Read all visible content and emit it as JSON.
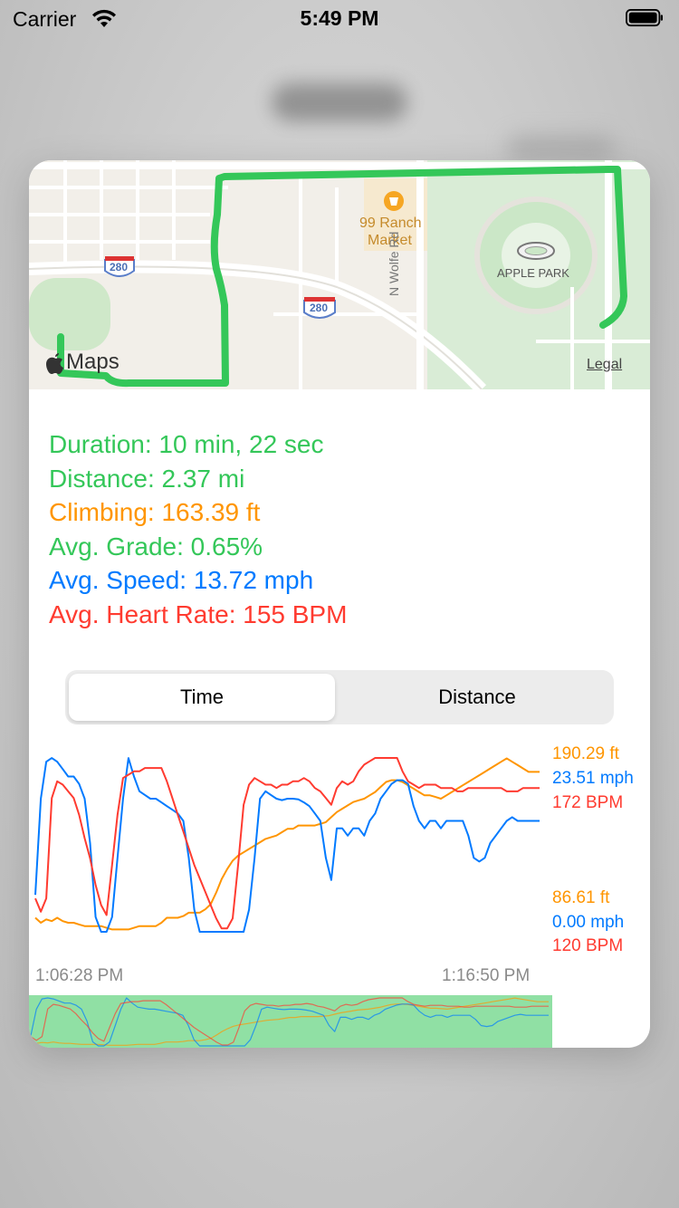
{
  "status_bar": {
    "carrier": "Carrier",
    "time": "5:49 PM"
  },
  "map": {
    "places": [
      "99 Ranch",
      "Market",
      "APPLE PARK",
      "N Wolfe Rd",
      "280",
      "280"
    ],
    "maps_brand": "Maps",
    "legal": "Legal",
    "route_color": "#34c759"
  },
  "stats": {
    "duration": "Duration: 10 min, 22 sec",
    "distance": "Distance: 2.37 mi",
    "climbing": "Climbing: 163.39 ft",
    "grade": "Avg. Grade: 0.65%",
    "speed": "Avg. Speed: 13.72 mph",
    "heart_rate": "Avg. Heart Rate: 155 BPM"
  },
  "segmented": {
    "options": [
      "Time",
      "Distance"
    ],
    "selected": "Time"
  },
  "colors": {
    "green": "#34c759",
    "orange": "#ff9500",
    "blue": "#007aff",
    "red": "#ff3b30"
  },
  "chart_data": {
    "type": "line",
    "x_start": "1:06:28 PM",
    "x_end": "1:16:50 PM",
    "series": [
      {
        "key": "elevation",
        "color": "#ff9500",
        "min_label": "86.61 ft",
        "max_label": "190.29 ft",
        "min": 86.61,
        "max": 190.29,
        "values": [
          95,
          92,
          94,
          93,
          95,
          93,
          92,
          92,
          91,
          90,
          90,
          90,
          90,
          89,
          88,
          88,
          88,
          88,
          89,
          90,
          90,
          90,
          90,
          92,
          95,
          95,
          95,
          96,
          98,
          98,
          98,
          100,
          103,
          110,
          118,
          124,
          129,
          132,
          134,
          136,
          138,
          140,
          142,
          143,
          144,
          146,
          148,
          148,
          150,
          150,
          150,
          150,
          151,
          152,
          155,
          158,
          160,
          162,
          164,
          165,
          166,
          168,
          170,
          173,
          176,
          177,
          177,
          176,
          174,
          172,
          170,
          168,
          168,
          167,
          166,
          168,
          170,
          172,
          174,
          176,
          178,
          180,
          182,
          184,
          186,
          188,
          190,
          188,
          186,
          184,
          182,
          182,
          182
        ]
      },
      {
        "key": "speed",
        "color": "#007aff",
        "min_label": "0.00 mph",
        "max_label": "23.51 mph",
        "min": 0,
        "max": 23.51,
        "values": [
          5,
          18,
          23,
          23.5,
          23,
          22,
          21,
          21,
          20,
          18,
          12,
          2,
          0,
          0,
          2,
          10,
          18,
          23.5,
          21,
          19,
          18.5,
          18,
          18,
          17.5,
          17,
          16.5,
          16,
          15,
          10,
          3,
          0,
          0,
          0,
          0,
          0,
          0,
          0,
          0,
          0,
          3,
          10,
          18,
          19,
          18.5,
          18,
          17.8,
          18,
          18,
          17.9,
          17.5,
          17,
          16,
          15,
          10,
          7,
          14,
          14,
          13,
          14,
          14,
          13,
          15,
          16,
          18,
          19,
          20,
          20.5,
          20.5,
          20,
          17,
          15,
          14,
          15,
          15,
          14,
          15,
          15,
          15,
          15,
          13,
          10,
          9.5,
          10,
          12,
          13,
          14,
          15,
          15.5,
          15,
          15,
          15,
          15,
          15
        ]
      },
      {
        "key": "heart_rate",
        "color": "#ff3b30",
        "min_label": "120 BPM",
        "max_label": "172 BPM",
        "min": 120,
        "max": 172,
        "values": [
          130,
          126,
          130,
          160,
          165,
          164,
          162,
          160,
          155,
          148,
          142,
          134,
          128,
          125,
          140,
          155,
          166,
          167,
          168,
          168,
          169,
          169,
          169,
          169,
          165,
          160,
          155,
          150,
          145,
          140,
          136,
          132,
          128,
          124,
          121,
          121,
          124,
          140,
          158,
          164,
          166,
          165,
          164,
          164,
          163,
          164,
          164,
          165,
          165,
          166,
          165,
          163,
          162,
          160,
          158,
          163,
          165,
          164,
          165,
          168,
          170,
          171,
          173,
          174,
          174,
          174,
          173,
          168,
          165,
          164,
          163,
          164,
          164,
          164,
          163,
          163,
          163,
          162,
          162,
          163,
          163,
          163,
          163,
          163,
          163,
          163,
          162,
          162,
          162,
          163,
          163,
          163,
          163
        ]
      }
    ]
  }
}
